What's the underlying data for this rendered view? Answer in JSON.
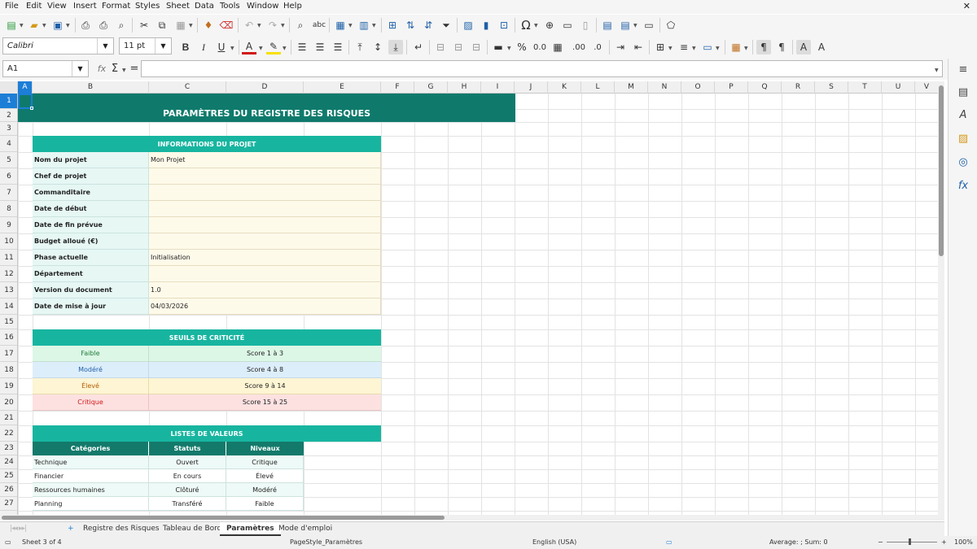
{
  "menu": [
    "File",
    "Edit",
    "View",
    "Insert",
    "Format",
    "Styles",
    "Sheet",
    "Data",
    "Tools",
    "Window",
    "Help"
  ],
  "font": {
    "name": "Calibri",
    "size": "11 pt"
  },
  "namebox": "A1",
  "formula_symbols": {
    "fx": "fx",
    "sum": "Σ",
    "eq": "="
  },
  "columns": [
    "A",
    "B",
    "C",
    "D",
    "E",
    "F",
    "G",
    "H",
    "I",
    "J",
    "K",
    "L",
    "M",
    "N",
    "O",
    "P",
    "Q",
    "R",
    "S",
    "T",
    "U",
    "V"
  ],
  "rows": [
    "1",
    "2",
    "3",
    "4",
    "5",
    "6",
    "7",
    "8",
    "9",
    "10",
    "11",
    "12",
    "13",
    "14",
    "15",
    "16",
    "17",
    "18",
    "19",
    "20",
    "21",
    "22",
    "23",
    "24",
    "25",
    "26",
    "27"
  ],
  "sheet": {
    "title": "PARAMÈTRES DU REGISTRE DES RISQUES",
    "project_header": "INFORMATIONS DU PROJET",
    "project_fields": [
      {
        "label": "Nom du projet",
        "value": "Mon Projet"
      },
      {
        "label": "Chef de projet",
        "value": ""
      },
      {
        "label": "Commanditaire",
        "value": ""
      },
      {
        "label": "Date de début",
        "value": ""
      },
      {
        "label": "Date de fin prévue",
        "value": ""
      },
      {
        "label": "Budget alloué (€)",
        "value": ""
      },
      {
        "label": "Phase actuelle",
        "value": "Initialisation"
      },
      {
        "label": "Département",
        "value": ""
      },
      {
        "label": "Version du document",
        "value": "1.0"
      },
      {
        "label": "Date de mise à jour",
        "value": "04/03/2026"
      }
    ],
    "threshold_header": "SEUILS DE CRITICITÉ",
    "thresholds": [
      {
        "level": "Faible",
        "range": "Score 1 à 3",
        "bg": "#dcf7e6",
        "fg": "#1d7a3a"
      },
      {
        "level": "Modéré",
        "range": "Score 4 à 8",
        "bg": "#ddeefb",
        "fg": "#1f5fa8"
      },
      {
        "level": "Élevé",
        "range": "Score 9 à 14",
        "bg": "#fdf5d3",
        "fg": "#b35c00"
      },
      {
        "level": "Critique",
        "range": "Score 15 à 25",
        "bg": "#fde1e1",
        "fg": "#d01818"
      }
    ],
    "lists_header": "LISTES DE VALEURS",
    "list_columns": [
      "Catégories",
      "Statuts",
      "Niveaux"
    ],
    "list_rows": [
      [
        "Technique",
        "Ouvert",
        "Critique"
      ],
      [
        "Financier",
        "En cours",
        "Élevé"
      ],
      [
        "Ressources humaines",
        "Clôturé",
        "Modéré"
      ],
      [
        "Planning",
        "Transféré",
        "Faible"
      ]
    ]
  },
  "tabs": [
    "Registre des Risques",
    "Tableau de Bord",
    "Paramètres",
    "Mode d'emploi"
  ],
  "active_tab": "Paramètres",
  "status": {
    "sheet": "Sheet 3 of 4",
    "pagestyle": "PageStyle_Paramètres",
    "language": "English (USA)",
    "summary": "Average: ; Sum: 0",
    "zoom": "100%"
  },
  "colors": {
    "teal_dark": "#0f7a6c",
    "teal": "#17b5a0",
    "dark_header": "#137a6b"
  }
}
